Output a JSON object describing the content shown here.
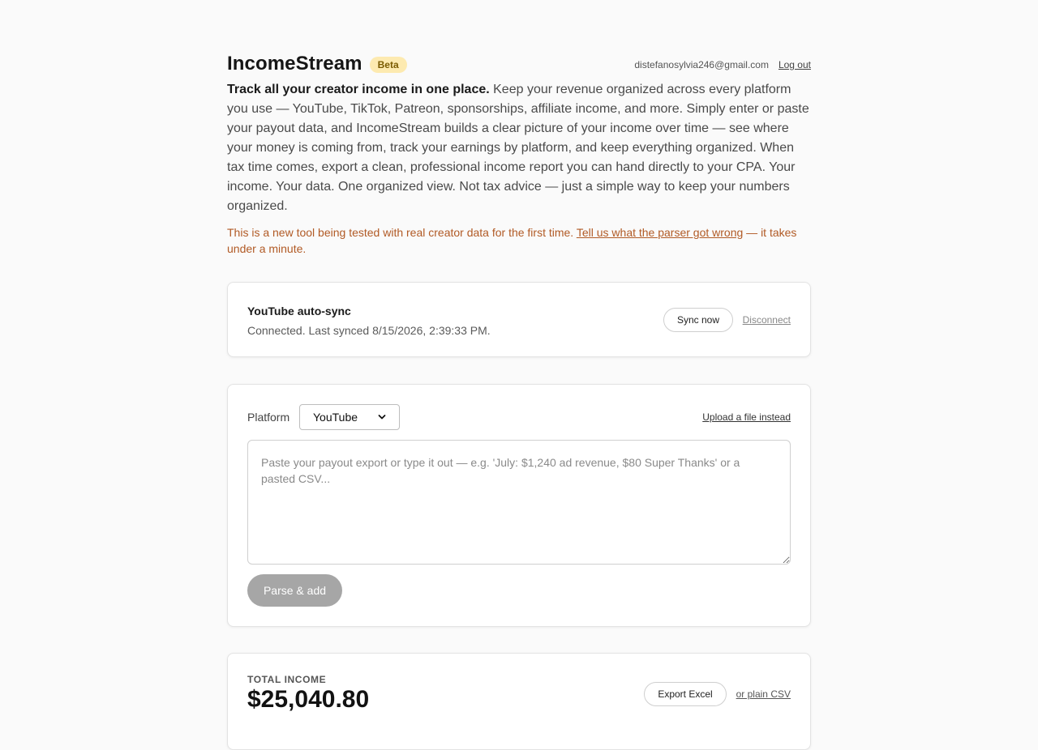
{
  "header": {
    "app_title": "IncomeStream",
    "badge": "Beta",
    "user_email": "distefanosylvia246@gmail.com",
    "logout_label": "Log out"
  },
  "intro": {
    "bold_lead": "Track all your creator income in one place.",
    "body": " Keep your revenue organized across every platform you use — YouTube, TikTok, Patreon, sponsorships, affiliate income, and more. Simply enter or paste your payout data, and IncomeStream builds a clear picture of your income over time — see where your money is coming from, track your earnings by platform, and keep everything organized. When tax time comes, export a clean, professional income report you can hand directly to your CPA. Your income. Your data. One organized view. Not tax advice — just a simple way to keep your numbers organized."
  },
  "notice": {
    "text_before": "This is a new tool being tested with real creator data for the first time. ",
    "link_label": "Tell us what the parser got wrong",
    "text_after": " — it takes under a minute."
  },
  "sync_card": {
    "title": "YouTube auto-sync",
    "status": "Connected. Last synced 8/15/2026, 2:39:33 PM.",
    "sync_button": "Sync now",
    "disconnect_label": "Disconnect"
  },
  "paste_card": {
    "platform_label": "Platform",
    "platform_selected": "YouTube",
    "upload_link": "Upload a file instead",
    "textarea_placeholder": "Paste your payout export or type it out — e.g. 'July: $1,240 ad revenue, $80 Super Thanks' or a pasted CSV...",
    "textarea_value": "",
    "parse_button": "Parse & add"
  },
  "total_card": {
    "label": "TOTAL INCOME",
    "value": "$25,040.80",
    "export_button": "Export Excel",
    "csv_link": "or plain CSV"
  },
  "icons": {
    "platform_select": "chevron-down-icon"
  },
  "colors": {
    "page_bg": "#fafafa",
    "badge_bg": "#fdeab0",
    "notice_text": "#b15a25",
    "disabled_button": "#a6a6a6"
  }
}
